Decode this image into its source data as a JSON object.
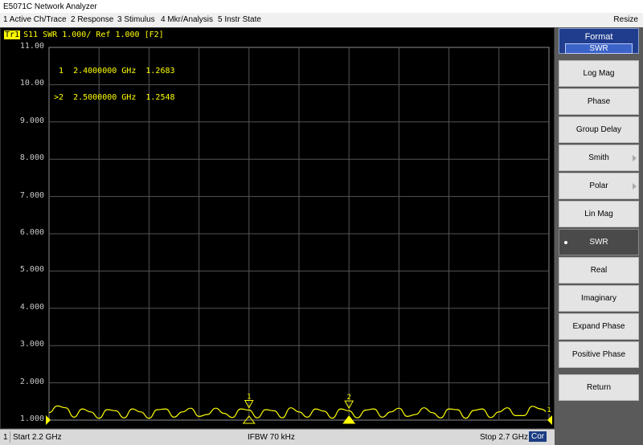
{
  "window": {
    "title": "E5071C Network Analyzer"
  },
  "menu": {
    "items": [
      "1 Active Ch/Trace",
      "2 Response",
      "3 Stimulus",
      "4 Mkr/Analysis",
      "5 Instr State"
    ],
    "resize": "Resize"
  },
  "trace": {
    "tag": "Tr1",
    "label": "S11  SWR 1.000/ Ref 1.000 [F2]",
    "color": "#ffff00"
  },
  "markers": {
    "lines": [
      " 1  2.4000000 GHz  1.2683",
      ">2  2.5000000 GHz  1.2548"
    ],
    "items": [
      {
        "id": "1",
        "freq_ghz": 2.4,
        "value": 1.2683,
        "active": false
      },
      {
        "id": "2",
        "freq_ghz": 2.5,
        "value": 1.2548,
        "active": true
      }
    ],
    "channel_tag": "1"
  },
  "chart_data": {
    "type": "line",
    "xlim": [
      2.2,
      2.7
    ],
    "ylim": [
      1.0,
      11.0
    ],
    "ytick_labels": [
      "11.00",
      "10.00",
      "9.000",
      "8.000",
      "7.000",
      "6.000",
      "5.000",
      "4.000",
      "3.000",
      "2.000",
      "1.000"
    ],
    "grid": true,
    "series": [
      {
        "x": [
          2.2,
          2.2083,
          2.2167,
          2.225,
          2.2333,
          2.2417,
          2.25,
          2.2583,
          2.2667,
          2.275,
          2.2833,
          2.2917,
          2.3,
          2.3083,
          2.3167,
          2.325,
          2.3333,
          2.3417,
          2.35,
          2.3583,
          2.3667,
          2.375,
          2.3833,
          2.3917,
          2.4,
          2.4083,
          2.4167,
          2.425,
          2.4333,
          2.4417,
          2.45,
          2.4583,
          2.4667,
          2.475,
          2.4833,
          2.4917,
          2.5,
          2.5083,
          2.5167,
          2.525,
          2.5333,
          2.5417,
          2.55,
          2.5583,
          2.5667,
          2.575,
          2.5833,
          2.5917,
          2.6,
          2.6083,
          2.6167,
          2.625,
          2.6333,
          2.6417,
          2.65,
          2.6583,
          2.6667,
          2.675,
          2.6833,
          2.6917,
          2.7
        ],
        "y": [
          1.2,
          1.38,
          1.33,
          1.08,
          1.3,
          1.22,
          1.05,
          1.28,
          1.25,
          1.06,
          1.3,
          1.22,
          1.05,
          1.28,
          1.3,
          1.08,
          1.22,
          1.32,
          1.1,
          1.15,
          1.32,
          1.18,
          1.07,
          1.3,
          1.27,
          1.06,
          1.28,
          1.25,
          1.06,
          1.33,
          1.22,
          1.08,
          1.3,
          1.24,
          1.05,
          1.3,
          1.25,
          1.06,
          1.27,
          1.3,
          1.08,
          1.22,
          1.32,
          1.1,
          1.15,
          1.33,
          1.2,
          1.06,
          1.3,
          1.28,
          1.05,
          1.26,
          1.3,
          1.07,
          1.22,
          1.33,
          1.12,
          1.12,
          1.37,
          1.3,
          1.2
        ]
      }
    ]
  },
  "status": {
    "channel": "1",
    "start": "Start 2.2 GHz",
    "ifbw": "IFBW 70 kHz",
    "stop": "Stop 2.7 GHz",
    "cor": "Cor"
  },
  "softkeys": {
    "header": "Format",
    "selected": "SWR",
    "items": [
      {
        "label": "Log Mag",
        "active": false,
        "submenu": false
      },
      {
        "label": "Phase",
        "active": false,
        "submenu": false
      },
      {
        "label": "Group Delay",
        "active": false,
        "submenu": false
      },
      {
        "label": "Smith",
        "active": false,
        "submenu": true
      },
      {
        "label": "Polar",
        "active": false,
        "submenu": true
      },
      {
        "label": "Lin Mag",
        "active": false,
        "submenu": false
      },
      {
        "label": "SWR",
        "active": true,
        "submenu": false
      },
      {
        "label": "Real",
        "active": false,
        "submenu": false
      },
      {
        "label": "Imaginary",
        "active": false,
        "submenu": false
      },
      {
        "label": "Expand Phase",
        "active": false,
        "submenu": false
      },
      {
        "label": "Positive Phase",
        "active": false,
        "submenu": false
      }
    ],
    "return_label": "Return"
  }
}
